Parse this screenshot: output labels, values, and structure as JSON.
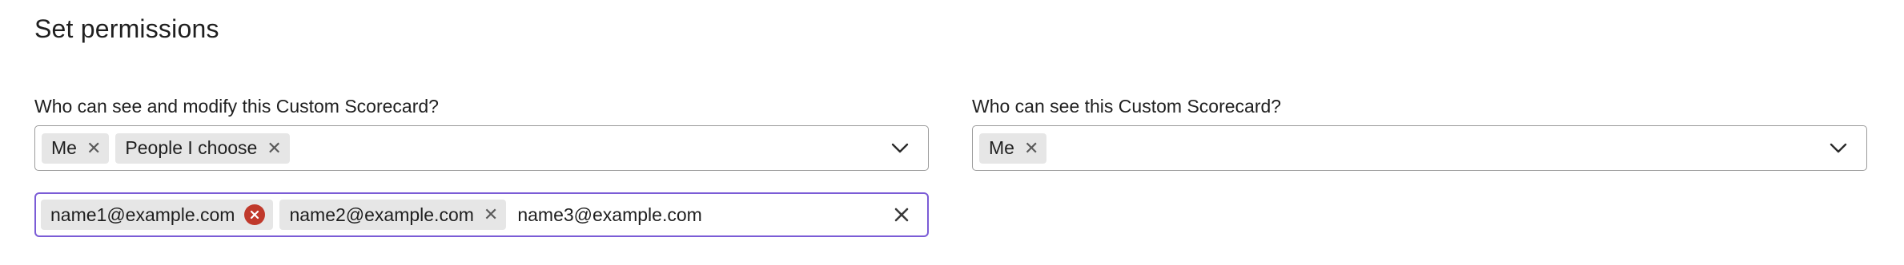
{
  "section": {
    "title": "Set permissions"
  },
  "modify_field": {
    "label": "Who can see and modify this Custom Scorecard?",
    "chips": [
      {
        "label": "Me"
      },
      {
        "label": "People I choose"
      }
    ],
    "icon": "chevron-down-icon"
  },
  "view_field": {
    "label": "Who can see this Custom Scorecard?",
    "chips": [
      {
        "label": "Me"
      }
    ],
    "icon": "chevron-down-icon"
  },
  "email_field": {
    "chips": [
      {
        "label": "name1@example.com",
        "state": "error"
      },
      {
        "label": "name2@example.com",
        "state": "normal"
      }
    ],
    "input_value": "name3@example.com",
    "clear_icon": "close-icon"
  },
  "colors": {
    "focus_border": "#7b5cd6",
    "error": "#c0392b",
    "chip_bg": "#e6e6e6"
  }
}
